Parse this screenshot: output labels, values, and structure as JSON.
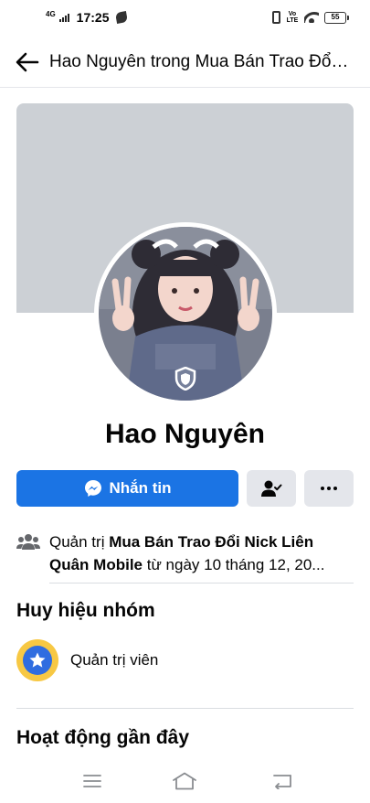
{
  "status_bar": {
    "network": "4G",
    "time": "17:25",
    "volte": "Vo LTE",
    "battery": "55"
  },
  "header": {
    "title": "Hao Nguyên trong Mua Bán Trao Đổi Nick Liên Quân Mobile"
  },
  "profile": {
    "name": "Hao Nguyên"
  },
  "actions": {
    "message_label": "Nhắn tin"
  },
  "admin_info": {
    "prefix": "Quản trị ",
    "group": "Mua Bán Trao Đổi Nick Liên Quân Mobile",
    "suffix": " từ ngày 10 tháng 12, 20..."
  },
  "badges": {
    "title": "Huy hiệu nhóm",
    "items": [
      {
        "label": "Quản trị viên"
      }
    ]
  },
  "recent_activity": {
    "title": "Hoạt động gần đây"
  },
  "colors": {
    "primary": "#1b74e4",
    "cover": "#ccd0d5",
    "secondary_button": "#e4e6eb",
    "badge_gold": "#f7c844"
  },
  "icons": {
    "back": "arrow-left-icon",
    "messenger": "messenger-icon",
    "friend": "friend-check-icon",
    "more": "more-dots-icon",
    "group": "group-people-icon",
    "admin_badge": "star-badge-icon"
  }
}
